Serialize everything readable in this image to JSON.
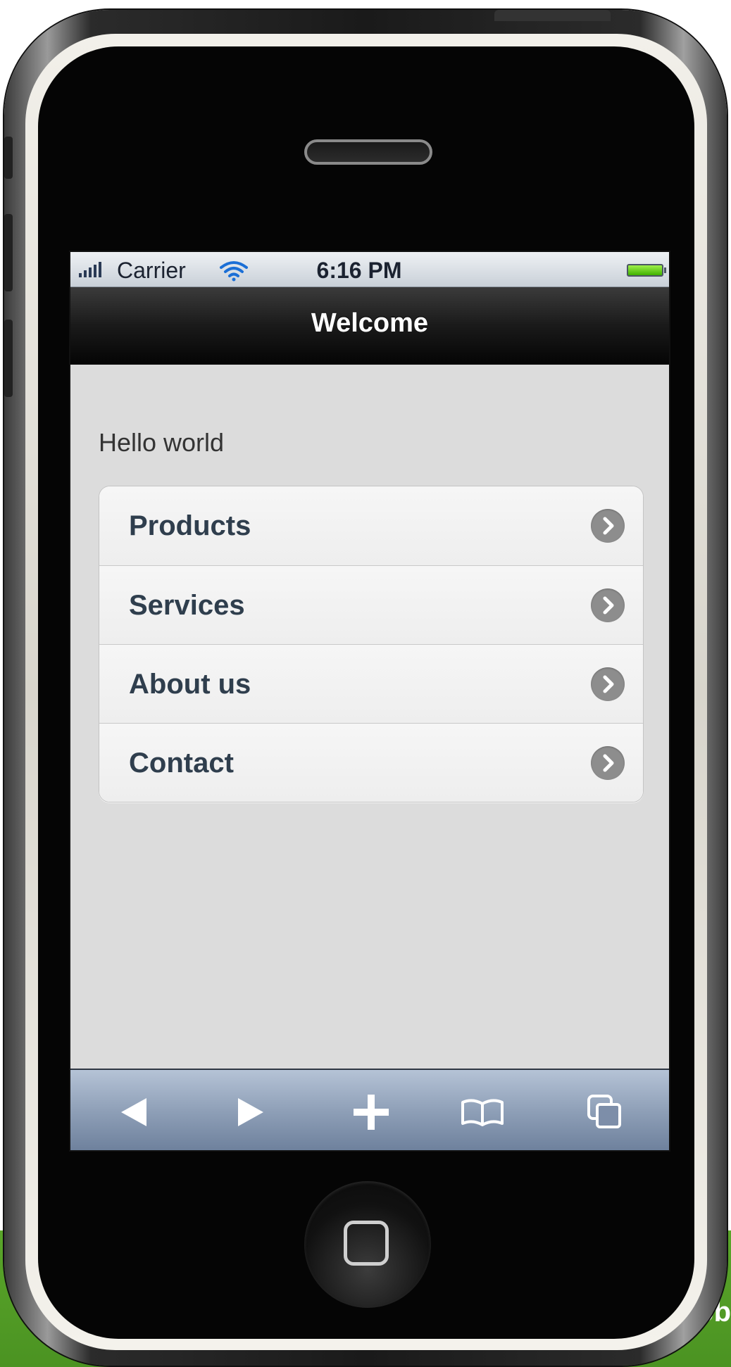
{
  "status_bar": {
    "carrier": "Carrier",
    "time": "6:16 PM",
    "signal_icon": "signal-bars-icon",
    "wifi_icon": "wifi-icon",
    "battery_icon": "battery-icon"
  },
  "header": {
    "title": "Welcome"
  },
  "main": {
    "greeting": "Hello world",
    "menu": [
      {
        "label": "Products",
        "icon": "chevron-right-icon"
      },
      {
        "label": "Services",
        "icon": "chevron-right-icon"
      },
      {
        "label": "About us",
        "icon": "chevron-right-icon"
      },
      {
        "label": "Contact",
        "icon": "chevron-right-icon"
      }
    ]
  },
  "toolbar": {
    "buttons": [
      {
        "name": "back",
        "icon": "back-arrow-icon"
      },
      {
        "name": "forward",
        "icon": "forward-arrow-icon"
      },
      {
        "name": "add",
        "icon": "plus-icon"
      },
      {
        "name": "bookmarks",
        "icon": "book-icon"
      },
      {
        "name": "pages",
        "icon": "pages-icon"
      }
    ]
  },
  "background_band": {
    "text_fragment": "lob",
    "color": "#4b9322"
  },
  "colors": {
    "title_bar": "#1a1a1a",
    "toolbar": "#8e9fb7",
    "menu_text": "#2f3e4d",
    "chevron": "#8d8d8d"
  }
}
